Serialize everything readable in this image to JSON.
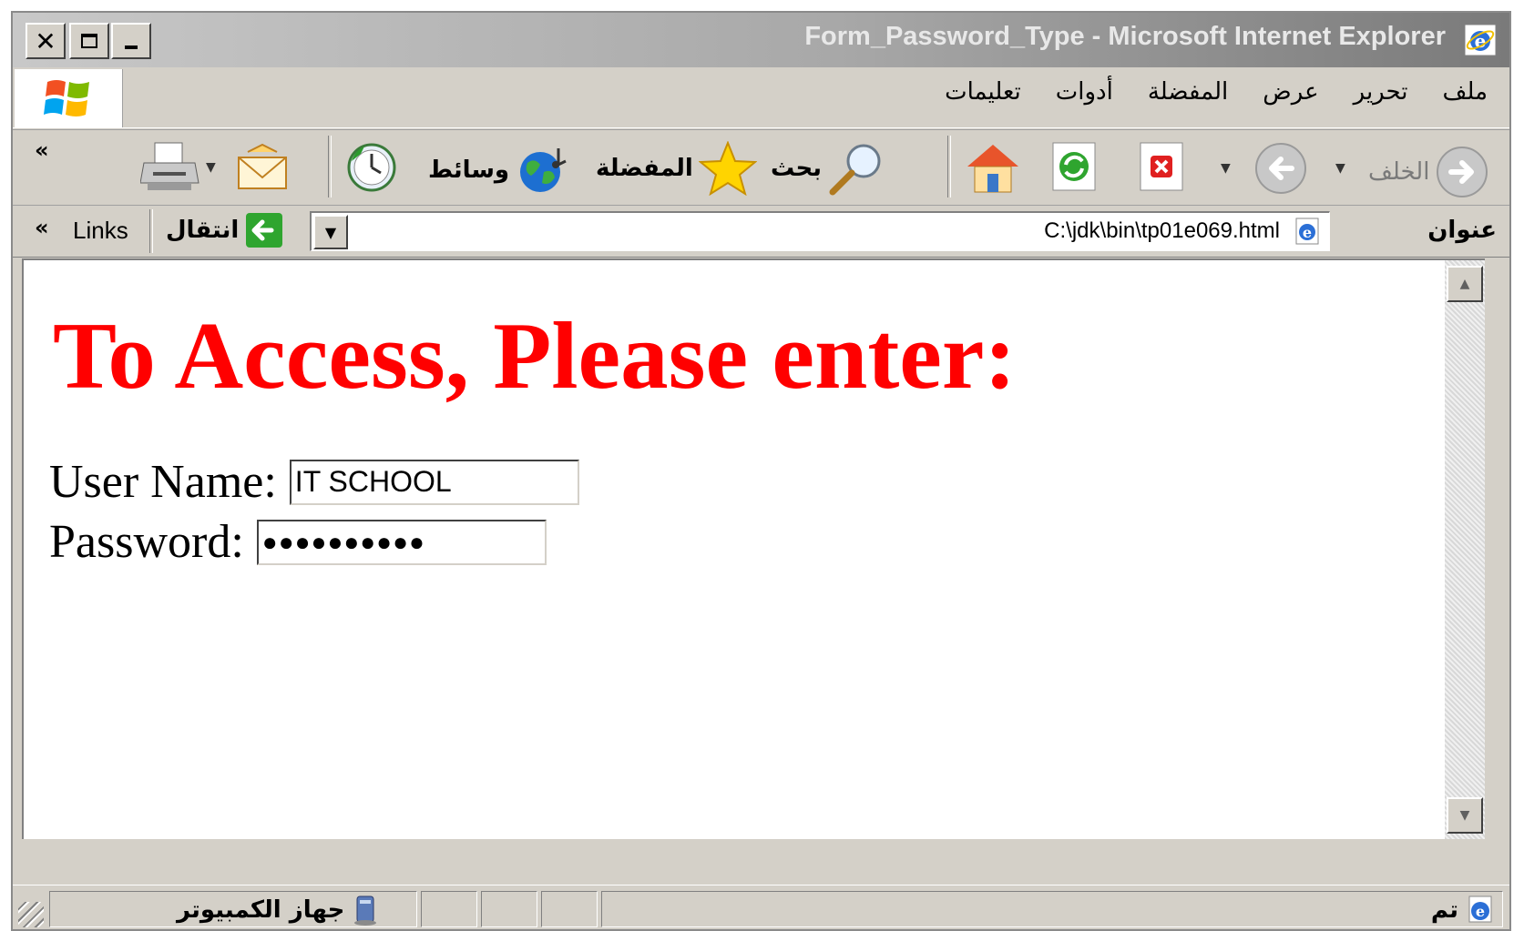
{
  "window": {
    "title": "Form_Password_Type - Microsoft Internet Explorer"
  },
  "menu": {
    "items": [
      "ملف",
      "تحرير",
      "عرض",
      "المفضلة",
      "أدوات",
      "تعليمات"
    ]
  },
  "toolbar": {
    "back_label": "الخلف",
    "search_label": "بحث",
    "favorites_label": "المفضلة",
    "media_label": "وسائط"
  },
  "address": {
    "label": "عنوان",
    "url": "C:\\jdk\\bin\\tp01e069.html",
    "go_label": "انتقال",
    "links_label": "Links"
  },
  "page": {
    "heading": "To Access, Please enter:",
    "username_label": "User Name:",
    "username_value": "IT SCHOOL",
    "password_label": "Password:",
    "password_mask": "●●●●●●●●●●"
  },
  "status": {
    "left_text": "تم",
    "zone_text": "جهاز الكمبيوتر"
  }
}
